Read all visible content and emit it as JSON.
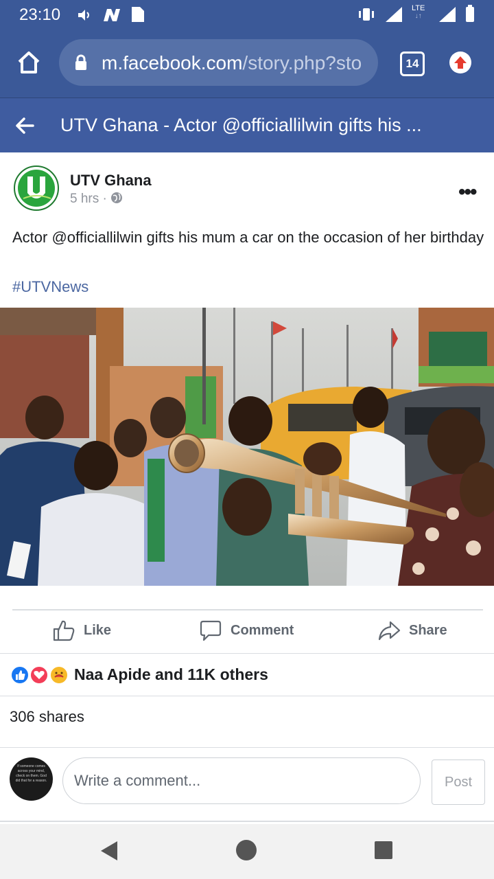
{
  "status_bar": {
    "time": "23:10",
    "network": "LTE",
    "icons": [
      "volume-icon",
      "n-badge-icon",
      "document-icon",
      "vibrate-icon",
      "signal-icon",
      "lte-icon",
      "signal-icon",
      "battery-icon"
    ]
  },
  "browser": {
    "url_domain": "m.facebook.com",
    "url_path": "/story.php?sto",
    "tab_count": "14",
    "icons": [
      "home-icon",
      "lock-icon",
      "upload-icon"
    ]
  },
  "header": {
    "title": "UTV Ghana - Actor @officiallilwin gifts his ..."
  },
  "post": {
    "page_name": "UTV Ghana",
    "time_ago": "5 hrs",
    "text": "Actor @officiallilwin gifts his mum a car on the occasion of her birthday",
    "hashtag": "#UTVNews",
    "actions": {
      "like": "Like",
      "comment": "Comment",
      "share": "Share"
    },
    "reactions_text": "Naa Apide and 11K others",
    "shares_text": "306 shares"
  },
  "comment_box": {
    "placeholder": "Write a comment...",
    "post_label": "Post",
    "avatar_quote": "If someone comes across your mind, check on them. God did that for a reason."
  },
  "colors": {
    "facebook_blue": "#3b5998",
    "header_blue": "#3f5ca0",
    "hashtag_blue": "#4b67a1",
    "utv_green": "#25a03a"
  }
}
